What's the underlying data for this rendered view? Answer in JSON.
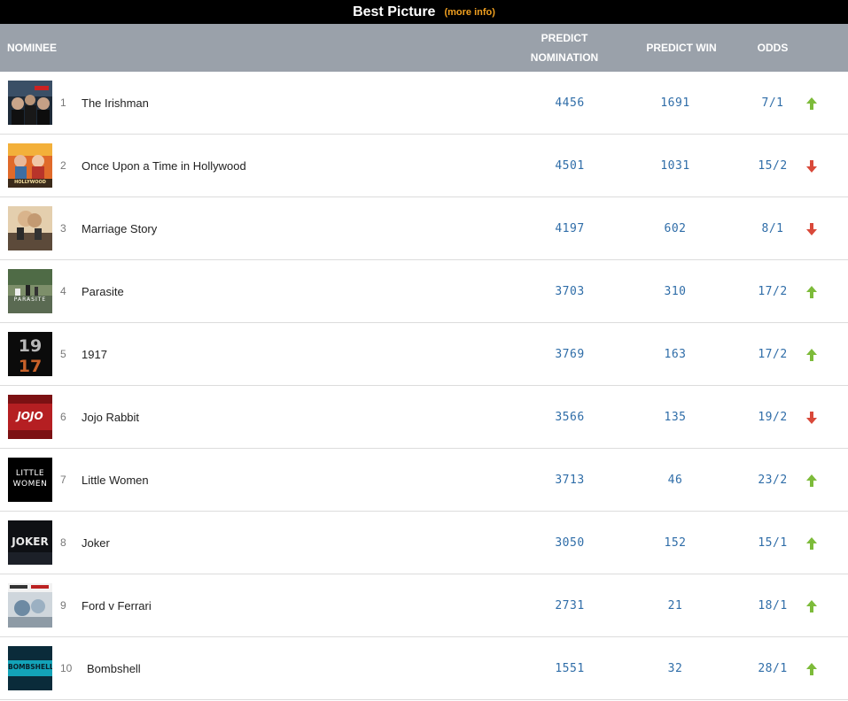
{
  "banner": {
    "title": "Best Picture",
    "more_info": "(more info)"
  },
  "columns": {
    "nominee": "NOMINEE",
    "predict_nomination_line1": "PREDICT",
    "predict_nomination_line2": "NOMINATION",
    "predict_win": "PREDICT WIN",
    "odds": "ODDS"
  },
  "colors": {
    "up": "#7dbb3a",
    "down": "#d9493a",
    "value": "#2f6da8",
    "header_bg": "#9aa1aa"
  },
  "nominees": [
    {
      "rank": "1",
      "title": "The Irishman",
      "predict_nomination": "4456",
      "predict_win": "1691",
      "odds": "7/1",
      "trend": "up"
    },
    {
      "rank": "2",
      "title": "Once Upon a Time in Hollywood",
      "predict_nomination": "4501",
      "predict_win": "1031",
      "odds": "15/2",
      "trend": "down",
      "poster_text": "HOLLYWOOD"
    },
    {
      "rank": "3",
      "title": "Marriage Story",
      "predict_nomination": "4197",
      "predict_win": "602",
      "odds": "8/1",
      "trend": "down"
    },
    {
      "rank": "4",
      "title": "Parasite",
      "predict_nomination": "3703",
      "predict_win": "310",
      "odds": "17/2",
      "trend": "up",
      "poster_text": "PARASITE"
    },
    {
      "rank": "5",
      "title": "1917",
      "predict_nomination": "3769",
      "predict_win": "163",
      "odds": "17/2",
      "trend": "up"
    },
    {
      "rank": "6",
      "title": "Jojo Rabbit",
      "predict_nomination": "3566",
      "predict_win": "135",
      "odds": "19/2",
      "trend": "down",
      "poster_text": "JOJO"
    },
    {
      "rank": "7",
      "title": "Little Women",
      "predict_nomination": "3713",
      "predict_win": "46",
      "odds": "23/2",
      "trend": "up",
      "poster_text": "LITTLE WOMEN"
    },
    {
      "rank": "8",
      "title": "Joker",
      "predict_nomination": "3050",
      "predict_win": "152",
      "odds": "15/1",
      "trend": "up",
      "poster_text": "JOKER"
    },
    {
      "rank": "9",
      "title": "Ford v Ferrari",
      "predict_nomination": "2731",
      "predict_win": "21",
      "odds": "18/1",
      "trend": "up"
    },
    {
      "rank": "10",
      "title": "Bombshell",
      "predict_nomination": "1551",
      "predict_win": "32",
      "odds": "28/1",
      "trend": "up",
      "poster_text": "BOMBSHELL"
    }
  ]
}
